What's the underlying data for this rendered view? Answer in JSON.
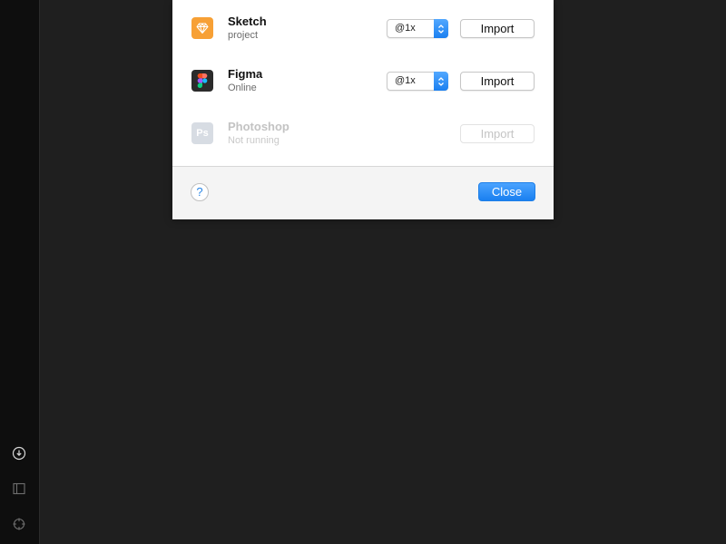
{
  "colors": {
    "background": "#1f1f1f",
    "sidebar": "#0e0e0e",
    "accent": "#1a80f0",
    "sketch_brand": "#f7a035",
    "figma_tile": "#2b2b2b",
    "photoshop_disabled": "#d7dce3"
  },
  "sidebar": {
    "items": [
      {
        "name": "download",
        "icon": "download-circle-icon"
      },
      {
        "name": "panel",
        "icon": "sidebar-panel-icon"
      },
      {
        "name": "target",
        "icon": "crosshair-icon"
      }
    ]
  },
  "dialog": {
    "apps": [
      {
        "name": "Sketch",
        "status": "project",
        "icon": "sketch-diamond-icon",
        "scale": "@1x",
        "import_label": "Import",
        "enabled": true
      },
      {
        "name": "Figma",
        "status": "Online",
        "icon": "figma-logo-icon",
        "scale": "@1x",
        "import_label": "Import",
        "enabled": true
      },
      {
        "name": "Photoshop",
        "status": "Not running",
        "icon": "photoshop-ps-icon",
        "icon_text": "Ps",
        "import_label": "Import",
        "enabled": false
      }
    ],
    "footer": {
      "help_label": "?",
      "close_label": "Close"
    }
  }
}
